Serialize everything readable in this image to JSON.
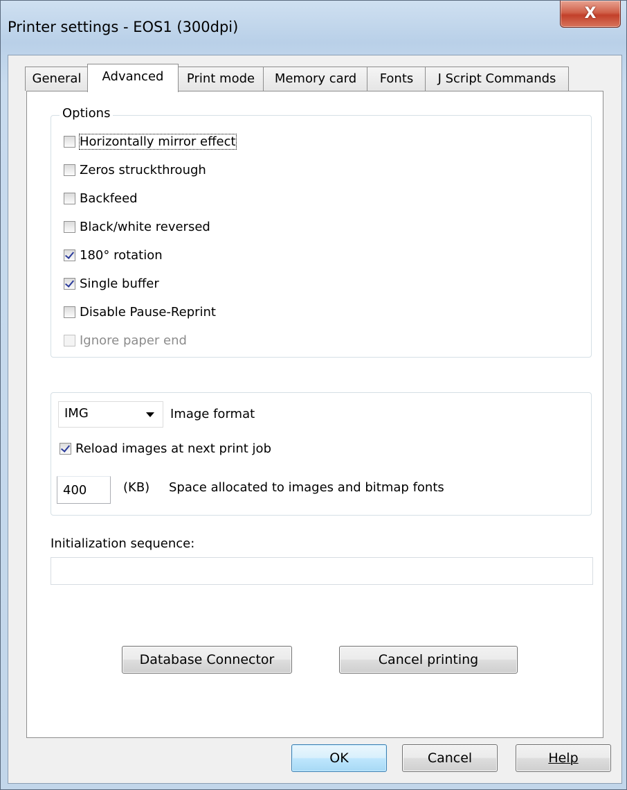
{
  "window": {
    "title": "Printer settings - EOS1 (300dpi)",
    "close_label": "X"
  },
  "tabs": [
    {
      "label": "General"
    },
    {
      "label": "Advanced",
      "active": true
    },
    {
      "label": "Print mode"
    },
    {
      "label": "Memory card"
    },
    {
      "label": "Fonts"
    },
    {
      "label": "J Script Commands"
    }
  ],
  "options": {
    "legend": "Options",
    "items": [
      {
        "label": "Horizontally mirror effect",
        "checked": false,
        "enabled": true,
        "focused": true
      },
      {
        "label": "Zeros struckthrough",
        "checked": false,
        "enabled": true
      },
      {
        "label": "Backfeed",
        "checked": false,
        "enabled": true
      },
      {
        "label": "Black/white reversed",
        "checked": false,
        "enabled": true
      },
      {
        "label": "180° rotation",
        "checked": true,
        "enabled": true
      },
      {
        "label": "Single buffer",
        "checked": true,
        "enabled": true
      },
      {
        "label": "Disable Pause-Reprint",
        "checked": false,
        "enabled": true
      },
      {
        "label": "Ignore paper end",
        "checked": false,
        "enabled": false
      }
    ]
  },
  "images": {
    "format_value": "IMG",
    "format_label": "Image format",
    "reload_label": "Reload images at next print job",
    "reload_checked": true,
    "space_value": "400",
    "space_unit": "(KB)",
    "space_label": "Space allocated to images and bitmap fonts"
  },
  "init": {
    "label": "Initialization sequence:",
    "value": ""
  },
  "buttons": {
    "database_connector": "Database Connector",
    "cancel_printing": "Cancel printing",
    "ok": "OK",
    "cancel": "Cancel",
    "help": "Help"
  },
  "colors": {
    "close_red": "#c2402a",
    "default_button": "#bee6fd",
    "check_mark": "#2a3a9a"
  }
}
